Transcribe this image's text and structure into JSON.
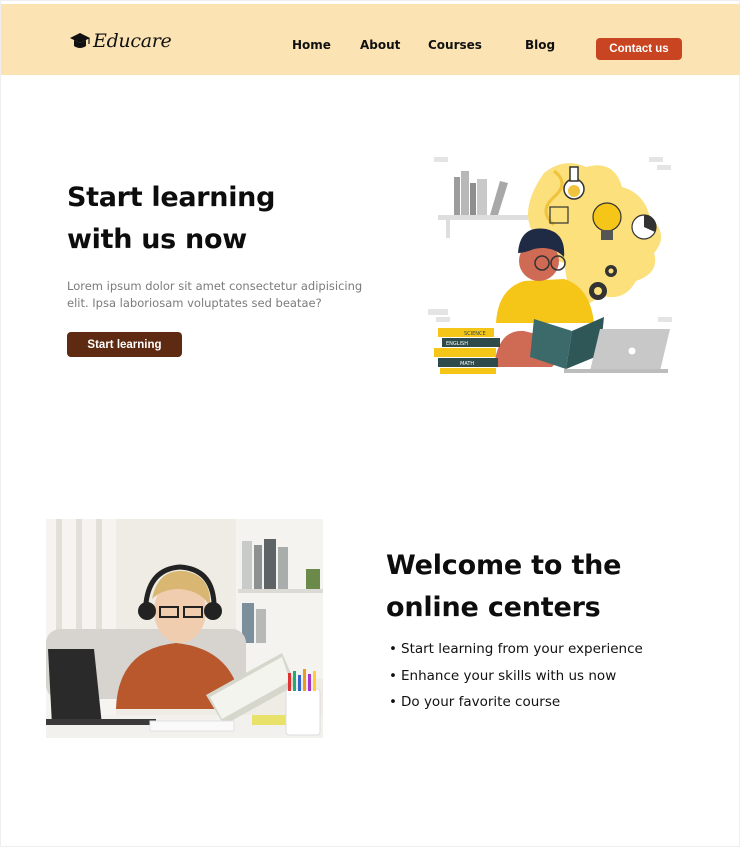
{
  "brand": {
    "name": "Educare"
  },
  "nav": {
    "home": "Home",
    "about": "About",
    "courses": "Courses",
    "blog": "Blog",
    "contact": "Contact us"
  },
  "hero": {
    "title_line1": "Start learning",
    "title_line2": "with us now",
    "text_line1": "Lorem ipsum dolor sit amet consectetur adipisicing",
    "text_line2": "elit. Ipsa laboriosam  voluptates sed beatae?",
    "cta": "Start learning",
    "book_labels": [
      "SCIENCE",
      "ENGLISH",
      "MATH"
    ]
  },
  "welcome": {
    "title_line1": "Welcome to the",
    "title_line2": "online centers",
    "items": [
      "Start learning from your experience",
      "Enhance your skills with us now",
      "Do your favorite course"
    ]
  },
  "colors": {
    "header_bg": "#fbe3b4",
    "contact_btn": "#c94420",
    "cta_btn": "#5e2a12",
    "illustration_yellow": "#f7d04b"
  }
}
